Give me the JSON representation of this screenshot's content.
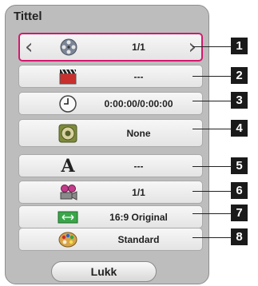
{
  "dialog": {
    "title": "Tittel",
    "close_label": "Lukk"
  },
  "rows": [
    {
      "index": "1",
      "icon": "film-reel-icon",
      "value": "1/1",
      "selected": true
    },
    {
      "index": "2",
      "icon": "clapperboard-icon",
      "value": "---"
    },
    {
      "index": "3",
      "icon": "clock-icon",
      "value": "0:00:00/0:00:00"
    },
    {
      "index": "4",
      "icon": "speaker-icon",
      "value": "None"
    },
    {
      "index": "5",
      "icon": "subtitle-a-icon",
      "value": "---"
    },
    {
      "index": "6",
      "icon": "camera-angle-icon",
      "value": "1/1"
    },
    {
      "index": "7",
      "icon": "aspect-ratio-icon",
      "value": "16:9 Original"
    },
    {
      "index": "8",
      "icon": "palette-icon",
      "value": "Standard"
    }
  ],
  "colors": {
    "selected_border": "#d4186d",
    "panel": "#bdbdbd",
    "badge": "#1a1a1a"
  }
}
